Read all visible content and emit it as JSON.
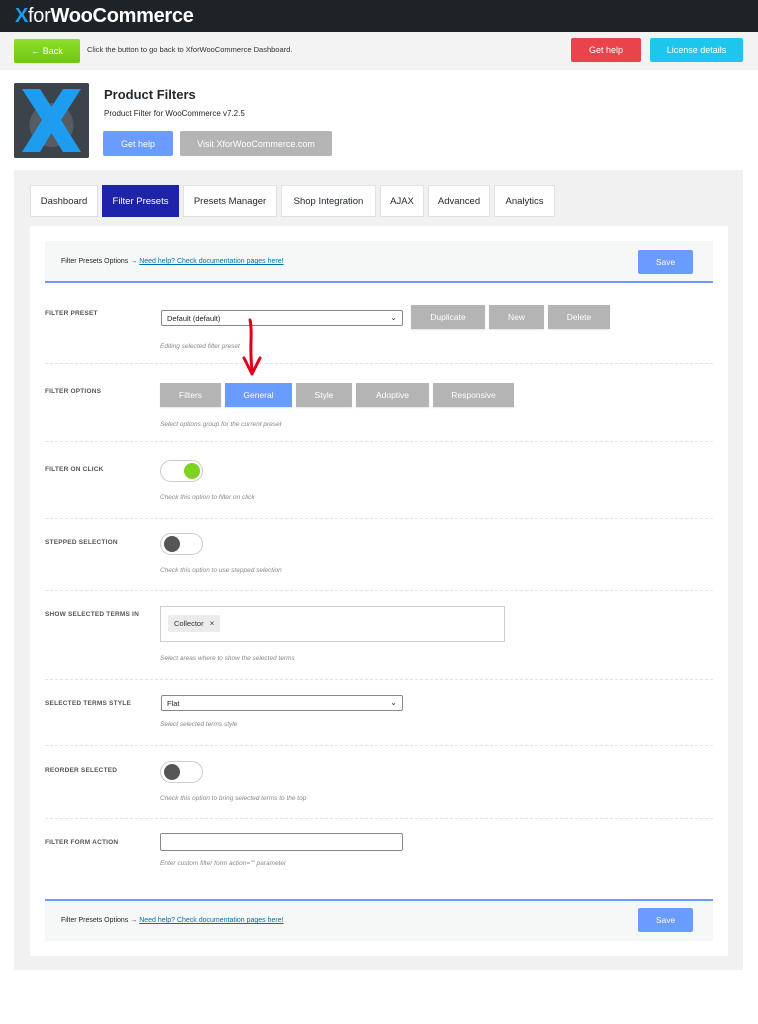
{
  "topbar": {
    "brand_x": "X",
    "brand_for": "for",
    "brand_name": "WooCommerce"
  },
  "subbar": {
    "back_label": "← Back",
    "back_hint": "Click the button to go back to XforWooCommerce Dashboard.",
    "get_help_label": "Get help",
    "license_label": "License details"
  },
  "plugin": {
    "title": "Product Filters",
    "subtitle": "Product Filter for WooCommerce v7.2.5",
    "get_help_label": "Get help",
    "visit_label": "Visit XforWooCommerce.com"
  },
  "tabs": [
    {
      "label": "Dashboard"
    },
    {
      "label": "Filter Presets",
      "active": true
    },
    {
      "label": "Presets Manager"
    },
    {
      "label": "Shop Integration"
    },
    {
      "label": "AJAX"
    },
    {
      "label": "Advanced"
    },
    {
      "label": "Analytics"
    }
  ],
  "savebar": {
    "text": "Filter Presets Options → ",
    "link": "Need help? Check documentation pages here!",
    "save_label": "Save"
  },
  "filter_preset": {
    "label": "FILTER PRESET",
    "selected": "Default (default)",
    "duplicate_label": "Duplicate",
    "new_label": "New",
    "delete_label": "Delete",
    "desc": "Editing selected filter preset"
  },
  "filter_options": {
    "label": "FILTER OPTIONS",
    "buttons": [
      "Filters",
      "General",
      "Style",
      "Adoptive",
      "Responsive"
    ],
    "active": "General",
    "desc": "Select options group for the current preset"
  },
  "filter_on_click": {
    "label": "FILTER ON CLICK",
    "value": true,
    "desc": "Check this option to filter on click"
  },
  "stepped_selection": {
    "label": "STEPPED SELECTION",
    "value": false,
    "desc": "Check this option to use stepped selection"
  },
  "show_selected_terms": {
    "label": "SHOW SELECTED TERMS IN",
    "tags": [
      "Collector"
    ],
    "desc": "Select areas where to show the selected terms"
  },
  "selected_terms_style": {
    "label": "SELECTED TERMS STYLE",
    "selected": "Flat",
    "desc": "Select selected terms style"
  },
  "reorder_selected": {
    "label": "REORDER SELECTED",
    "value": false,
    "desc": "Check this option to bring selected terms to the top"
  },
  "filter_form_action": {
    "label": "FILTER FORM ACTION",
    "value": "",
    "desc": "Enter custom filter form action=\"\" parameter"
  },
  "colors": {
    "accent": "#6a9bfe",
    "active_tab": "#1e24a8",
    "toggle_on": "#7ed321",
    "danger": "#e9434b",
    "info": "#1ec6ee",
    "annotation_arrow": "#e0001b"
  }
}
